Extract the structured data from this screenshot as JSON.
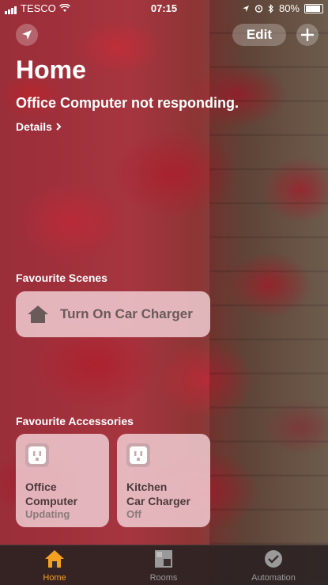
{
  "status_bar": {
    "carrier": "TESCO",
    "time": "07:15",
    "battery": "80%"
  },
  "header": {
    "edit_label": "Edit"
  },
  "home": {
    "title": "Home",
    "alert": "Office Computer not responding.",
    "details": "Details"
  },
  "scenes": {
    "label": "Favourite Scenes",
    "items": [
      {
        "label": "Turn On Car Charger",
        "icon": "house-icon"
      }
    ]
  },
  "accessories": {
    "label": "Favourite Accessories",
    "items": [
      {
        "name_line1": "Office",
        "name_line2": "Computer",
        "status": "Updating",
        "icon": "outlet-icon"
      },
      {
        "name_line1": "Kitchen",
        "name_line2": "Car Charger",
        "status": "Off",
        "icon": "outlet-icon"
      }
    ]
  },
  "tabs": [
    {
      "label": "Home",
      "active": true,
      "icon": "house-icon"
    },
    {
      "label": "Rooms",
      "active": false,
      "icon": "rooms-icon"
    },
    {
      "label": "Automation",
      "active": false,
      "icon": "clock-icon"
    }
  ],
  "colors": {
    "accent": "#f4a020"
  }
}
